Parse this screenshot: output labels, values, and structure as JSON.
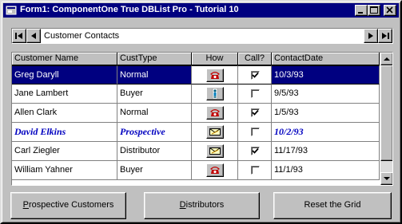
{
  "window": {
    "title": "Form1:  ComponentOne True DBList Pro - Tutorial 10",
    "controls": [
      "minimize-icon",
      "maximize-icon",
      "close-icon"
    ]
  },
  "navigator": {
    "caption": "Customer Contacts",
    "buttons": [
      "first-record-icon",
      "previous-record-icon",
      "next-record-icon",
      "last-record-icon"
    ]
  },
  "grid": {
    "columns": [
      "Customer Name",
      "CustType",
      "How",
      "Call?",
      "ContactDate"
    ],
    "rows": [
      {
        "name": "Greg Daryll",
        "type": "Normal",
        "how": "phone-icon",
        "call": true,
        "date": "10/3/93",
        "selected": true,
        "prospect": false
      },
      {
        "name": "Jane Lambert",
        "type": "Buyer",
        "how": "person-icon",
        "call": false,
        "date": "9/5/93",
        "selected": false,
        "prospect": false
      },
      {
        "name": "Allen Clark",
        "type": "Normal",
        "how": "phone-icon",
        "call": true,
        "date": "1/5/93",
        "selected": false,
        "prospect": false
      },
      {
        "name": "David Elkins",
        "type": "Prospective",
        "how": "mail-icon",
        "call": false,
        "date": "10/2/93",
        "selected": false,
        "prospect": true
      },
      {
        "name": "Carl Ziegler",
        "type": "Distributor",
        "how": "mail-icon",
        "call": true,
        "date": "11/17/93",
        "selected": false,
        "prospect": false
      },
      {
        "name": "William Yahner",
        "type": "Buyer",
        "how": "phone-icon",
        "call": false,
        "date": "11/1/93",
        "selected": false,
        "prospect": false
      }
    ]
  },
  "buttons": {
    "prospective": {
      "prefix": "",
      "accel": "P",
      "rest": "rospective Customers"
    },
    "distributors": {
      "prefix": "",
      "accel": "D",
      "rest": "istributors"
    },
    "reset": {
      "label": "Reset the Grid"
    }
  },
  "colors": {
    "title_bar": "#000080",
    "selection": "#000080",
    "prospect_text": "#0000c0",
    "face": "#c0c0c0"
  }
}
